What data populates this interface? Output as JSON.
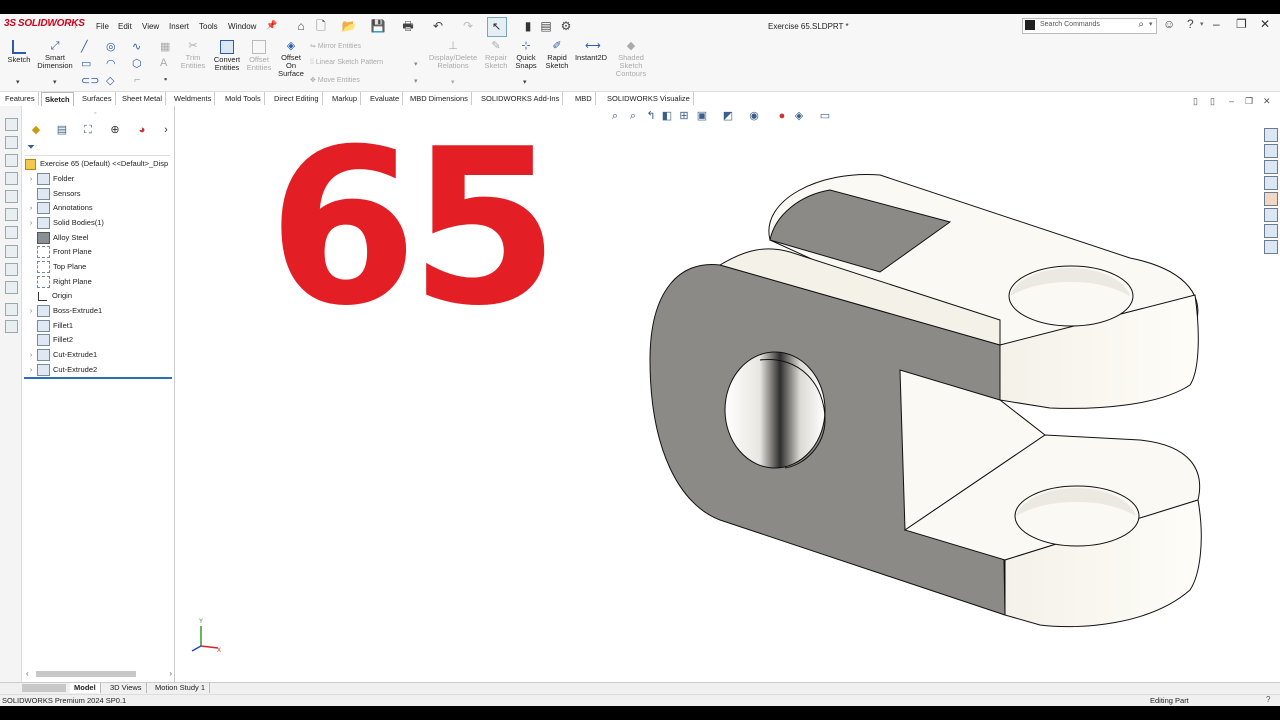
{
  "app": {
    "brand_prefix": "3S",
    "brand_name": "SOLIDWORKS",
    "document_title": "Exercise 65.SLDPRT *"
  },
  "menu": [
    "File",
    "Edit",
    "View",
    "Insert",
    "Tools",
    "Window"
  ],
  "search": {
    "placeholder": "Search Commands"
  },
  "command_manager": {
    "sketch": "Sketch",
    "smart_dimension_1": "Smart",
    "smart_dimension_2": "Dimension",
    "trim_1": "Trim",
    "trim_2": "Entities",
    "convert_1": "Convert",
    "convert_2": "Entities",
    "offset_1": "Offset",
    "offset_2": "Entities",
    "offset_surface_1": "Offset",
    "offset_surface_2": "On",
    "offset_surface_3": "Surface",
    "mirror": "Mirror Entities",
    "linear_pattern": "Linear Sketch Pattern",
    "move": "Move Entities",
    "display_delete_1": "Display/Delete",
    "display_delete_2": "Relations",
    "repair_1": "Repair",
    "repair_2": "Sketch",
    "quick_snaps_1": "Quick",
    "quick_snaps_2": "Snaps",
    "rapid_1": "Rapid",
    "rapid_2": "Sketch",
    "instant2d": "Instant2D",
    "shaded_1": "Shaded",
    "shaded_2": "Sketch",
    "shaded_3": "Contours"
  },
  "tabs": [
    "Features",
    "Sketch",
    "Surfaces",
    "Sheet Metal",
    "Weldments",
    "Mold Tools",
    "Direct Editing",
    "Markup",
    "Evaluate",
    "MBD Dimensions",
    "SOLIDWORKS Add-Ins",
    "MBD",
    "SOLIDWORKS Visualize"
  ],
  "active_tab": "Sketch",
  "feature_tree": {
    "root": "Exercise 65 (Default) <<Default>_Disp",
    "items": [
      {
        "label": "Folder",
        "expandable": true,
        "icon": "folder-icon"
      },
      {
        "label": "Sensors",
        "expandable": false,
        "icon": "sensor-icon"
      },
      {
        "label": "Annotations",
        "expandable": true,
        "icon": "annotation-icon"
      },
      {
        "label": "Solid Bodies(1)",
        "expandable": true,
        "icon": "solid-bodies-icon"
      },
      {
        "label": "Alloy Steel",
        "expandable": false,
        "icon": "material-icon"
      },
      {
        "label": "Front Plane",
        "expandable": false,
        "icon": "plane-icon"
      },
      {
        "label": "Top Plane",
        "expandable": false,
        "icon": "plane-icon"
      },
      {
        "label": "Right Plane",
        "expandable": false,
        "icon": "plane-icon"
      },
      {
        "label": "Origin",
        "expandable": false,
        "icon": "origin-icon"
      },
      {
        "label": "Boss-Extrude1",
        "expandable": true,
        "icon": "extrude-icon"
      },
      {
        "label": "Fillet1",
        "expandable": false,
        "icon": "fillet-icon"
      },
      {
        "label": "Fillet2",
        "expandable": false,
        "icon": "fillet-icon"
      },
      {
        "label": "Cut-Extrude1",
        "expandable": true,
        "icon": "cut-icon"
      },
      {
        "label": "Cut-Extrude2",
        "expandable": true,
        "icon": "cut-icon"
      }
    ]
  },
  "viewport": {
    "overlay_number": "65",
    "overlay_color": "#e31e24",
    "triad_y": "Y",
    "triad_x": "X"
  },
  "bottom_tabs": [
    "Model",
    "3D Views",
    "Motion Study 1"
  ],
  "active_bottom_tab": "Model",
  "status": {
    "left": "SOLIDWORKS Premium 2024 SP0.1",
    "right": "Editing Part"
  },
  "colors": {
    "brand": "#d0021b",
    "part_face_light": "#fbf9f3",
    "part_face_dark": "#8c8a86"
  }
}
